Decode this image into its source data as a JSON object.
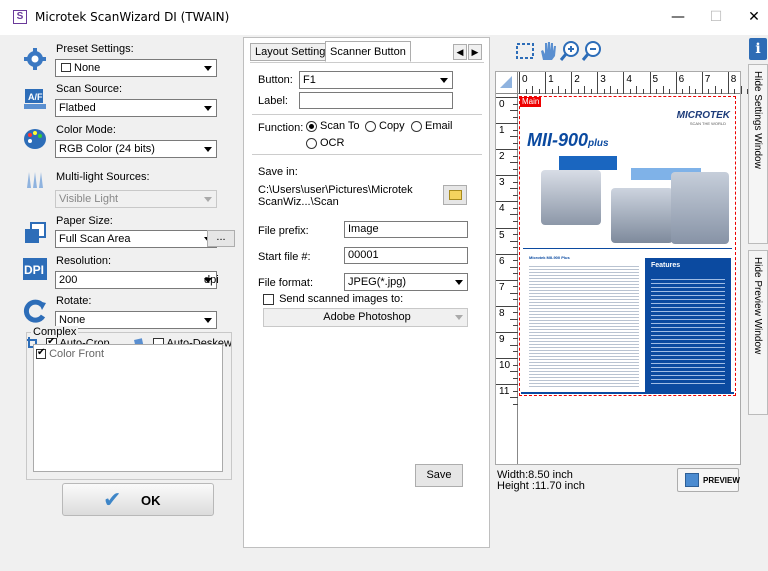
{
  "window": {
    "title": "Microtek ScanWizard DI (TWAIN)",
    "app_icon": "S",
    "minimize": "—",
    "maximize": "☐",
    "close": "✕"
  },
  "left": {
    "preset_label": "Preset Settings:",
    "preset_value": "None",
    "source_label": "Scan Source:",
    "source_value": "Flatbed",
    "color_label": "Color Mode:",
    "color_value": "RGB Color (24 bits)",
    "multilight_label": "Multi-light Sources:",
    "multilight_value": "Visible Light",
    "paper_label": "Paper Size:",
    "paper_value": "Full Scan Area",
    "paper_more": "...",
    "resolution_label": "Resolution:",
    "resolution_value": "200",
    "resolution_unit": "dpi",
    "rotate_label": "Rotate:",
    "rotate_value": "None",
    "autocrop_label": "Auto-Crop",
    "autodeskew_label": "Auto-Deskew",
    "complex_label": "Complex",
    "complex_item": "Color Front",
    "ok_label": "OK",
    "icons": {
      "preset": "gear-icon",
      "source": "flatbed-icon",
      "color": "palette-icon",
      "multilight": "multilight-icon",
      "paper": "paper-size-icon",
      "resolution": "dpi-icon",
      "rotate": "rotate-icon",
      "autocrop": "crop-icon",
      "autodeskew": "deskew-icon",
      "ok": "checkmark-icon"
    },
    "autocrop_checked": true,
    "autodeskew_checked": false,
    "complex_checked": true
  },
  "middle": {
    "tabs": [
      "Layout Settings",
      "Scanner Button"
    ],
    "active_tab": "Scanner Button",
    "tab_prev": "◀",
    "tab_next": "▶",
    "button_label": "Button:",
    "button_value": "F1",
    "label_label": "Label:",
    "label_value": "",
    "function_label": "Function:",
    "function_options": [
      "Scan To",
      "Copy",
      "Email",
      "OCR"
    ],
    "function_selected": "Scan To",
    "save_in_label": "Save in:",
    "save_in_path_1": "C:\\Users\\user\\Pictures\\Microtek",
    "save_in_path_2": "ScanWiz...\\Scan",
    "file_prefix_label": "File prefix:",
    "file_prefix_value": "Image",
    "start_file_label": "Start file #:",
    "start_file_value": "00001",
    "file_format_label": "File format:",
    "file_format_value": "JPEG(*.jpg)",
    "send_to_label": "Send scanned images to:",
    "send_to_app": "Adobe Photoshop",
    "save_button": "Save"
  },
  "preview": {
    "ruler_top": [
      "0",
      "1",
      "2",
      "3",
      "4",
      "5",
      "6",
      "7",
      "8"
    ],
    "ruler_left": [
      "0",
      "1",
      "2",
      "3",
      "4",
      "5",
      "6",
      "7",
      "8",
      "9",
      "10",
      "11"
    ],
    "main_tag": "Main",
    "brochure_brand": "MICROTEK",
    "brochure_tagline": "SCAN THE WORLD",
    "brochure_model": "MII-900",
    "brochure_model_suffix": "plus",
    "brochure_subtitle": "Microtek MII-900 Plus",
    "brochure_features": "Features",
    "width_label": "Width:8.50 inch",
    "height_label": "Height :11.70 inch",
    "preview_button": "PREVIEW",
    "tools": [
      "marquee-icon",
      "hand-icon",
      "zoom-in-icon",
      "zoom-out-icon"
    ]
  },
  "side_tabs": {
    "info": "i",
    "hide_settings": "Hide Settings Window",
    "hide_preview": "Hide Preview Window"
  }
}
